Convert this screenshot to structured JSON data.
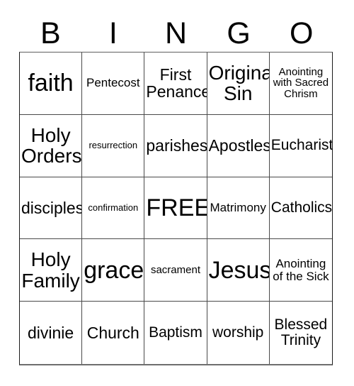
{
  "header": {
    "letters": [
      "B",
      "I",
      "N",
      "G",
      "O"
    ]
  },
  "colors": {
    "background": "#ffffff",
    "text": "#000000",
    "grid_border": "#4a4a4a",
    "outer_border": "#1a1a1a",
    "bottom_border": "#6e6e6e"
  },
  "card": {
    "rows": [
      [
        {
          "text": "faith",
          "size": "fs-xxl"
        },
        {
          "text": "Pentecost",
          "size": "fs-sm"
        },
        {
          "text": "First Penance",
          "size": "fs-lg"
        },
        {
          "text": "Original Sin",
          "size": "fs-xl"
        },
        {
          "text": "Anointing with Sacred Chrism",
          "size": "fs-xs"
        }
      ],
      [
        {
          "text": "Holy Orders",
          "size": "fs-xl"
        },
        {
          "text": "resurrection",
          "size": "fs-xxs"
        },
        {
          "text": "parishes",
          "size": "fs-lg"
        },
        {
          "text": "Apostles",
          "size": "fs-lg"
        },
        {
          "text": "Eucharist",
          "size": "fs-md"
        }
      ],
      [
        {
          "text": "disciples",
          "size": "fs-lg"
        },
        {
          "text": "confirmation",
          "size": "fs-xxs"
        },
        {
          "text": "FREE!",
          "size": "fs-xxl"
        },
        {
          "text": "Matrimony",
          "size": "fs-sm"
        },
        {
          "text": "Catholics",
          "size": "fs-md"
        }
      ],
      [
        {
          "text": "Holy Family",
          "size": "fs-xl"
        },
        {
          "text": "grace",
          "size": "fs-xxl"
        },
        {
          "text": "sacrament",
          "size": "fs-xs"
        },
        {
          "text": "Jesus",
          "size": "fs-xxl"
        },
        {
          "text": "Anointing of the Sick",
          "size": "fs-sm"
        }
      ],
      [
        {
          "text": "divinie",
          "size": "fs-lg"
        },
        {
          "text": "Church",
          "size": "fs-lg"
        },
        {
          "text": "Baptism",
          "size": "fs-md"
        },
        {
          "text": "worship",
          "size": "fs-md"
        },
        {
          "text": "Blessed Trinity",
          "size": "fs-md"
        }
      ]
    ]
  }
}
